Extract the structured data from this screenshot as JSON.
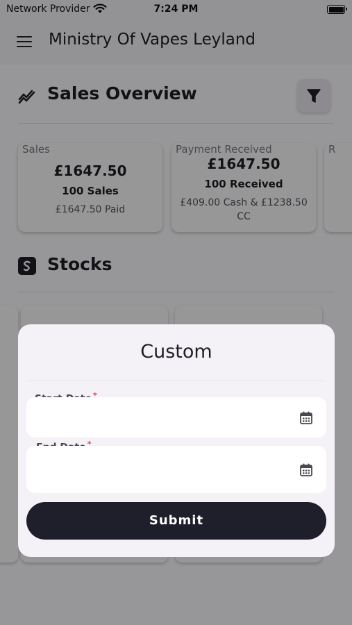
{
  "status_bar": {
    "carrier": "Network Provider",
    "time": "7:24 PM"
  },
  "app_bar": {
    "title": "Ministry Of Vapes Leyland",
    "menu_icon": "hamburger-menu-icon"
  },
  "sales_overview": {
    "title": "Sales Overview",
    "icon": "trending-chart-icon",
    "filter_icon": "filter-funnel-icon",
    "cards": [
      {
        "label": "Sales",
        "amount": "£1647.50",
        "count": "100 Sales",
        "detail": "£1647.50 Paid"
      },
      {
        "label": "Payment Received",
        "amount": "£1647.50",
        "count": "100 Received",
        "detail": "£409.00 Cash & £1238.50 CC"
      },
      {
        "label": "R"
      }
    ]
  },
  "stocks": {
    "title": "Stocks",
    "icon": "stocks-s-icon"
  },
  "modal": {
    "title": "Custom",
    "start_date": {
      "label": "Start Date",
      "required_mark": "*",
      "value": ""
    },
    "end_date": {
      "label": "End Date",
      "required_mark": "*",
      "value": ""
    },
    "calendar_icon": "calendar-icon",
    "submit_label": "Submit"
  },
  "colors": {
    "primary": "#1f1f2b",
    "accent_required": "#d94848",
    "modal_bg": "#f4f1f7"
  }
}
